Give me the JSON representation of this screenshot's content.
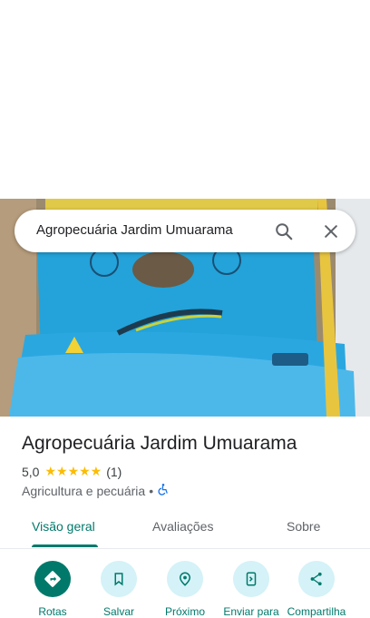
{
  "search": {
    "query": "Agropecuária Jardim Umuarama"
  },
  "place": {
    "name": "Agropecuária Jardim Umuarama",
    "rating": "5,0",
    "stars": "★★★★★",
    "review_count": "(1)",
    "category": "Agricultura e pecuária",
    "separator": "•"
  },
  "tabs": [
    {
      "label": "Visão geral",
      "active": true
    },
    {
      "label": "Avaliações",
      "active": false
    },
    {
      "label": "Sobre",
      "active": false
    }
  ],
  "actions": [
    {
      "label": "Rotas",
      "icon": "directions-icon"
    },
    {
      "label": "Salvar",
      "icon": "bookmark-icon"
    },
    {
      "label": "Próximo",
      "icon": "nearby-icon"
    },
    {
      "label": "Enviar para",
      "icon": "send-to-phone-icon"
    },
    {
      "label": "Compartilha",
      "icon": "share-icon"
    }
  ],
  "colors": {
    "accent": "#00796b",
    "action_bg": "#d4f2f7",
    "star": "#fbbc04"
  }
}
